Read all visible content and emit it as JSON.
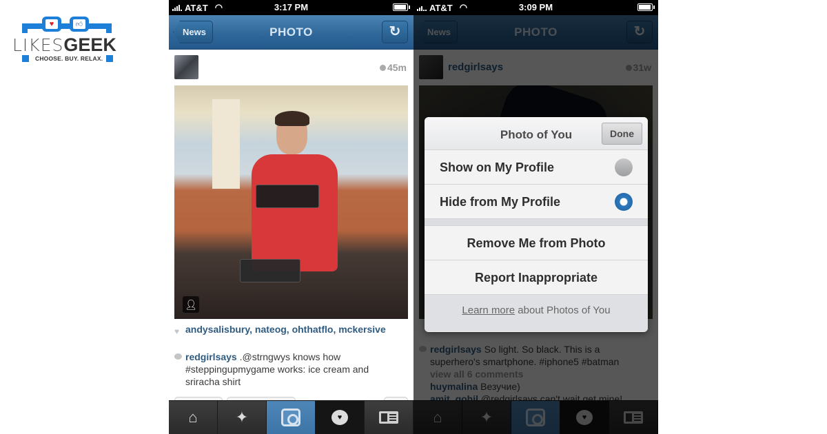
{
  "logo": {
    "word_light": "LIKES",
    "word_bold": "GEEK",
    "tagline": "CHOOSE. BUY. RELAX.",
    "brand_color": "#1e7fd8"
  },
  "left_phone": {
    "status": {
      "carrier": "AT&T",
      "time": "3:17 PM",
      "battery": 0.85
    },
    "nav": {
      "back_label": "News",
      "title": "PHOTO",
      "refresh_icon": "refresh-icon"
    },
    "post": {
      "username": "",
      "age": "45m",
      "likes": [
        "andysalisbury",
        "nateog",
        "ohthatflo",
        "mckersive"
      ],
      "caption": {
        "user": "redgirlsays",
        "text": " .@strngwys knows how #steppingupmygame works: ice cream and sriracha shirt"
      }
    },
    "tabs": [
      {
        "name": "home",
        "icon": "home-icon"
      },
      {
        "name": "explore",
        "icon": "explore-icon"
      },
      {
        "name": "camera",
        "icon": "camera-icon",
        "active": true
      },
      {
        "name": "activity",
        "icon": "activity-icon"
      },
      {
        "name": "profile",
        "icon": "news-icon"
      }
    ]
  },
  "right_phone": {
    "status": {
      "carrier": "AT&T",
      "time": "3:09 PM",
      "battery": 0.85
    },
    "nav": {
      "back_label": "News",
      "title": "PHOTO"
    },
    "post": {
      "username": "redgirlsays",
      "age": "31w",
      "caption": {
        "user": "redgirlsays",
        "text": " So light. So black. This is a superhero's smartphone. #iphone5 #batman"
      },
      "view_all": "view all 6 comments",
      "comments": [
        {
          "user": "huymalina",
          "text": " Везучие)"
        },
        {
          "user": "amit_gohil",
          "text": " @redgirlsays can't wait get mine!"
        }
      ]
    },
    "dialog": {
      "title": "Photo of You",
      "done_label": "Done",
      "options": [
        {
          "label": "Show on My Profile",
          "selected": false
        },
        {
          "label": "Hide from My Profile",
          "selected": true
        }
      ],
      "actions": [
        "Remove Me from Photo",
        "Report Inappropriate"
      ],
      "footer_link": "Learn more",
      "footer_text": " about Photos of You"
    }
  }
}
